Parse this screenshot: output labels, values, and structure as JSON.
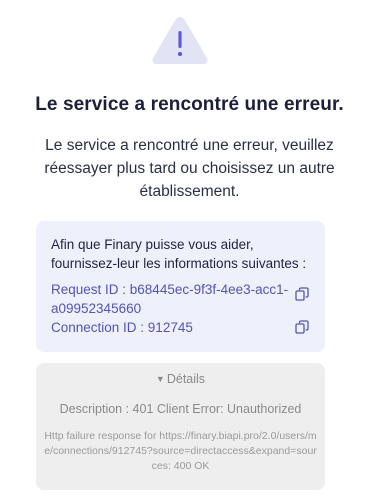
{
  "icon": "warning-triangle-icon",
  "colors": {
    "warning_triangle": "#e2e4f6",
    "warning_mark": "#5b5bd6",
    "info_card_bg": "#eef0fc",
    "info_link": "#5454b8",
    "details_card_bg": "#eeeeee"
  },
  "title": "Le service a rencontré une erreur.",
  "message": "Le service a rencontré une erreur, veuillez réessayer plus tard ou choisissez un autre établissement.",
  "info": {
    "intro": "Afin que Finary puisse vous aider, fournissez-leur les informations suivantes :",
    "request_id": "Request ID : b68445ec-9f3f-4ee3-acc1-a09952345660",
    "connection_id": "Connection ID : 912745",
    "copy_icon": "copy-icon"
  },
  "details": {
    "toggle_label": "Détails",
    "toggle_icon": "triangle-down-icon",
    "description": "Description : 401 Client Error: Unauthorized",
    "http_message": "Http failure response for https://finary.biapi.pro/2.0/users/me/connections/912745?source=directaccess&expand=sources: 400 OK"
  }
}
